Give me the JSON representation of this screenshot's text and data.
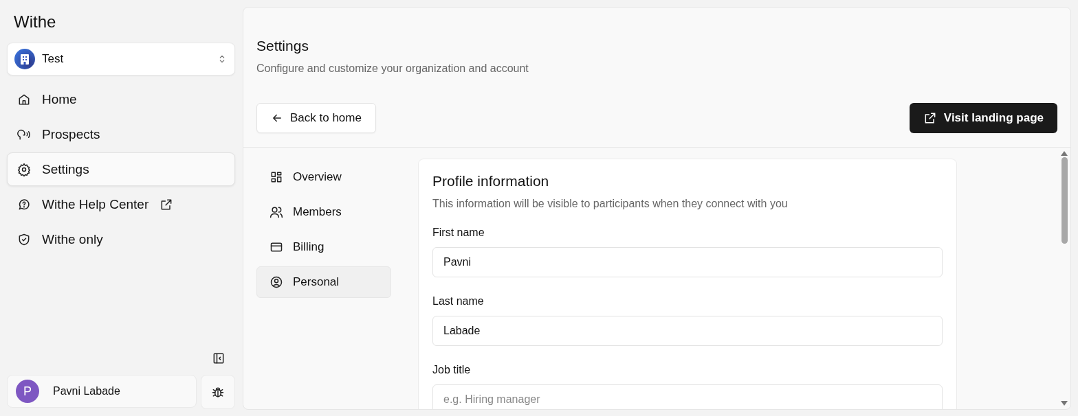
{
  "sidebar": {
    "brand": "Withe",
    "workspace": {
      "name": "Test"
    },
    "items": [
      {
        "label": "Home",
        "selected": false,
        "external": false
      },
      {
        "label": "Prospects",
        "selected": false,
        "external": false
      },
      {
        "label": "Settings",
        "selected": true,
        "external": false
      },
      {
        "label": "Withe Help Center",
        "selected": false,
        "external": true
      },
      {
        "label": "Withe only",
        "selected": false,
        "external": false
      }
    ],
    "user": {
      "initial": "P",
      "name": "Pavni Labade"
    }
  },
  "header": {
    "title": "Settings",
    "subtitle": "Configure and customize your organization and account",
    "back_button": "Back to home",
    "landing_button": "Visit landing page"
  },
  "tabs": [
    {
      "label": "Overview",
      "selected": false
    },
    {
      "label": "Members",
      "selected": false
    },
    {
      "label": "Billing",
      "selected": false
    },
    {
      "label": "Personal",
      "selected": true
    }
  ],
  "profile": {
    "title": "Profile information",
    "description": "This information will be visible to participants when they connect with you",
    "fields": [
      {
        "label": "First name",
        "value": "Pavni"
      },
      {
        "label": "Last name",
        "value": "Labade"
      },
      {
        "label": "Job title",
        "placeholder": "e.g. Hiring manager"
      }
    ]
  }
}
